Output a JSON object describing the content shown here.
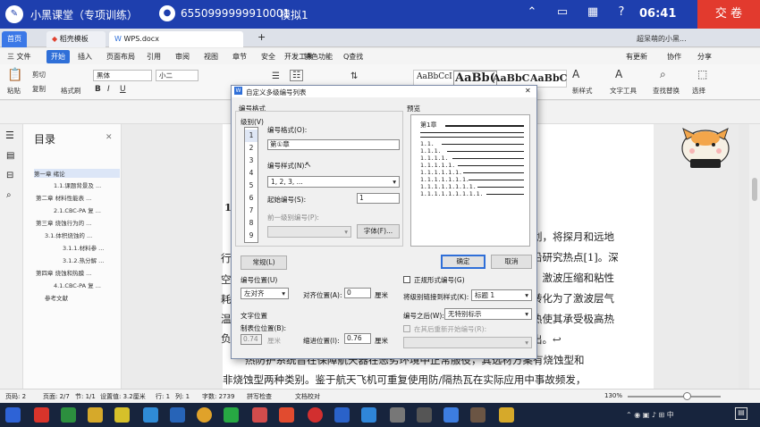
{
  "app": {
    "title": "小黑课堂（专项训练）",
    "user_id": "6550999999910001",
    "mode": "模拟1",
    "clock": "06:41",
    "submit": "交 卷"
  },
  "tabs": {
    "home": "首页",
    "template": "稻壳模板",
    "doc": "WPS.docx",
    "new": "+",
    "account": "超呆萌的小黑..."
  },
  "menu": {
    "file": "三 文件",
    "start": "开始",
    "insert": "插入",
    "layout": "页面布局",
    "ref": "引用",
    "review": "审阅",
    "view": "视图",
    "chapter": "章节",
    "security": "安全",
    "dev": "开发工具",
    "special": "特色功能",
    "search": "Q查找",
    "update": "有更新",
    "collab": "协作",
    "share": "分享"
  },
  "ribbon": {
    "paste": "粘贴",
    "cut": "剪切",
    "copy": "复制",
    "format_painter": "格式刷",
    "font": "黑体",
    "size": "小二",
    "bold": "B",
    "italic": "I",
    "underline": "U",
    "style_normal": "AaBbCcI",
    "style_h1": "AaBb(",
    "style_h2": "AaBbC",
    "style_h3": "AaBbC",
    "new_style": "新样式",
    "text_tools": "文字工具",
    "find_replace": "查找替换",
    "select": "选择"
  },
  "toc": {
    "header": "目录",
    "items": [
      "第一章 绪论",
      "1.1.课题背景及 ...",
      "第二章 材料性能表 ...",
      "2.1.CBC-PA 复 ...",
      "第三章 烧蚀行为的 ...",
      "3.1.体积烧蚀的 ...",
      "3.1.1.材料参 ...",
      "3.1.2.热分解 ...",
      "第四章 烧蚀和热膜 ...",
      "4.1.CBC-PA 复 ...",
      "参考文献"
    ]
  },
  "doc": {
    "l1": "划，将探月和远地",
    "l2": "沿研究热点[1]。深",
    "l3": "，激波压缩和粘性",
    "l4": "转化为了激波层气",
    "l5": "热使其承受极高热",
    "l6": "出。↩",
    "l7": "热防护系统旨在保障航天器在恶劣环境中正常服役，其选材方案有烧蚀型和",
    "l8": "非烧蚀型两种类别。鉴于航天飞机可重复使用防/隔热瓦在实际应用中事故频发，",
    "left_1": "1.",
    "left_chars": [
      "行",
      "空",
      "耗",
      "温",
      "负"
    ]
  },
  "status": {
    "page": "页码: 2",
    "pages": "页面: 2/7",
    "section": "节: 1/1",
    "pos": "设置值: 3.2厘米",
    "row": "行: 1",
    "col": "列: 1",
    "words": "字数: 2739",
    "spell": "拼写检查",
    "proof": "文档校对",
    "zoom": "130%"
  },
  "dialog": {
    "title": "自定义多级编号列表",
    "numbering_format": "编号格式",
    "level_label": "级别(V)",
    "levels": [
      "1",
      "2",
      "3",
      "4",
      "5",
      "6",
      "7",
      "8",
      "9"
    ],
    "format_label": "编号格式(O):",
    "format_value": "第①章",
    "style_label": "编号样式(N):",
    "style_value": "1, 2, 3, ...",
    "start_label": "起始编号(S):",
    "start_value": "1",
    "prev_level_label": "前一级别编号(P):",
    "font_btn": "字体(F)...",
    "preview_label": "预览",
    "preview_top": "第1章",
    "preview_lines": [
      "1.1.",
      "1.1.1.",
      "1.1.1.1.",
      "1.1.1.1.1.",
      "1.1.1.1.1.1.",
      "1.1.1.1.1.1.1.",
      "1.1.1.1.1.1.1.1.",
      "1.1.1.1.1.1.1.1.1."
    ],
    "general": "常规(L)",
    "ok": "确定",
    "cancel": "取消",
    "position_label": "编号位置(U)",
    "align_value": "左对齐",
    "align_at_label": "对齐位置(A):",
    "align_at_value": "0",
    "unit": "厘米",
    "text_pos_label": "文字位置",
    "tab_label": "制表位位置(B):",
    "tab_value": "0.74",
    "indent_label": "缩进位置(I):",
    "indent_value": "0.76",
    "legal_label": "正规形式编号(G)",
    "link_label": "将级别链接到样式(K):",
    "link_value": "标题 1",
    "after_label": "编号之后(W):",
    "after_value": "无特别标示",
    "restart_label": "在其后重新开始编号(R):"
  }
}
